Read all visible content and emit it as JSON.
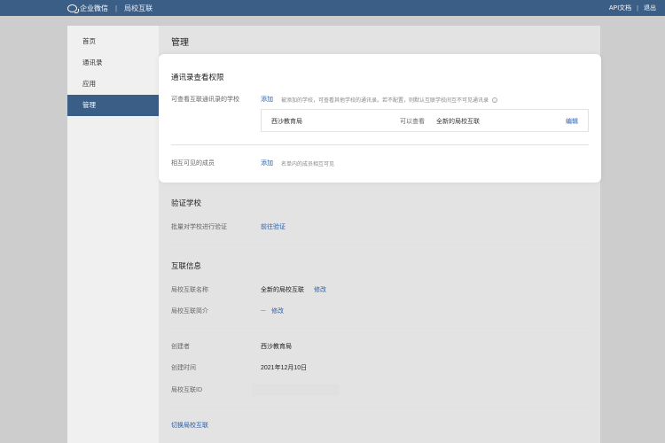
{
  "topbar": {
    "brand": "企业微信",
    "product": "局校互联",
    "api_docs": "API文档",
    "divider": "|",
    "logout": "退出"
  },
  "sidebar": {
    "items": [
      {
        "label": "首页"
      },
      {
        "label": "通讯录"
      },
      {
        "label": "应用"
      },
      {
        "label": "管理",
        "active": true
      }
    ]
  },
  "main": {
    "title": "管理"
  },
  "visibility": {
    "title": "通讯录查看权限",
    "schools_label": "可查看互联通讯录的学校",
    "add_label": "添加",
    "hint": "被添加的学校，可查看其他学校的通讯录。若不配置，则默认互联学校间互不可见通讯录",
    "info_icon": "i",
    "row": {
      "school": "西沙教育局",
      "permission": "可以查看",
      "scope": "全新的局校互联",
      "edit": "编辑"
    },
    "members_label": "相互可见的成员",
    "members_add": "添加",
    "members_hint": "名单内的成员相互可见"
  },
  "verify": {
    "title": "验证学校",
    "label": "批量对学校进行验证",
    "action": "前往验证"
  },
  "info": {
    "title": "互联信息",
    "name_label": "局校互联名称",
    "name_value": "全新的局校互联",
    "name_edit": "修改",
    "intro_label": "局校互联简介",
    "intro_value": "...",
    "intro_edit": "修改",
    "creator_label": "创建者",
    "creator_value": "西沙教育局",
    "created_label": "创建时间",
    "created_value": "2021年12月10日",
    "id_label": "局校互联ID",
    "switch_label": "切换局校互联"
  },
  "colors": {
    "topbar": "#3b5e87",
    "active_nav": "#3b5e87",
    "link": "#2a5ea8"
  }
}
